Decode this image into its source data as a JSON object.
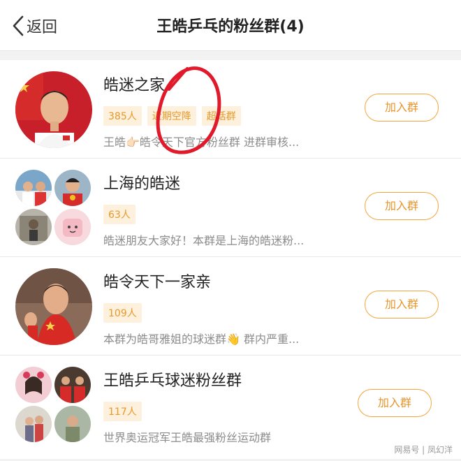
{
  "nav": {
    "back_label": "返回",
    "title": "王皓乒乓的粉丝群(4)"
  },
  "groups": [
    {
      "name": "皓迷之家",
      "tags": [
        "385人",
        "近期空降",
        "超话群"
      ],
      "description": "王皓👉🏻皓令天下官方粉丝群 进群审核...",
      "join_label": "加入群"
    },
    {
      "name": "上海的皓迷",
      "tags": [
        "63人"
      ],
      "description": "皓迷朋友大家好！本群是上海的皓迷粉...",
      "join_label": "加入群"
    },
    {
      "name": "皓令天下一家亲",
      "tags": [
        "109人"
      ],
      "description": "本群为皓哥雅姐的球迷群👋 群内严重...",
      "join_label": "加入群"
    },
    {
      "name": "王皓乒乓球迷粉丝群",
      "tags": [
        "117人"
      ],
      "description": "世界奥运冠军王皓最强粉丝运动群",
      "join_label": "加入群"
    }
  ],
  "watermark": "网易号 | 凤幻洋",
  "colors": {
    "accent": "#f3a53c",
    "tag_bg": "#fdf0dc",
    "annotation": "#e0192b"
  }
}
